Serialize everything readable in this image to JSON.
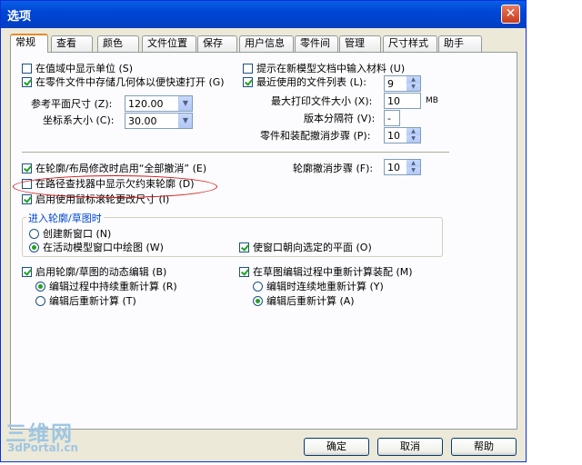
{
  "window": {
    "title": "选项",
    "close_glyph": "✕"
  },
  "tabs": [
    {
      "label": "常规"
    },
    {
      "label": "查看"
    },
    {
      "label": "颜色"
    },
    {
      "label": "文件位置"
    },
    {
      "label": "保存"
    },
    {
      "label": "用户信息"
    },
    {
      "label": "零件间"
    },
    {
      "label": "管理"
    },
    {
      "label": "尺寸样式"
    },
    {
      "label": "助手"
    }
  ],
  "active_tab": "常规",
  "general": {
    "show_units": {
      "label": "在值域中显示单位 (S)",
      "checked": false
    },
    "store_geometry": {
      "label": "在零件文件中存储几何体以便快速打开 (G)",
      "checked": true
    },
    "ref_plane_size": {
      "label": "参考平面尺寸 (Z):",
      "value": "120.00"
    },
    "coord_size": {
      "label": "坐标系大小 (C):",
      "value": "30.00"
    },
    "prompt_material": {
      "label": "提示在新模型文档中输入材料 (U)",
      "checked": false
    },
    "recent_files": {
      "label": "最近使用的文件列表 (L):",
      "checked": true,
      "value": "9"
    },
    "max_print": {
      "label": "最大打印文件大小 (X):",
      "value": "10",
      "unit": "MB"
    },
    "version_sep": {
      "label": "版本分隔符 (V):",
      "value": "-"
    },
    "undo_steps": {
      "label": "零件和装配撤消步骤 (P):",
      "value": "10"
    },
    "undo_all_profile": {
      "label": "在轮廓/布局修改时启用“全部撤消” (E)",
      "checked": true
    },
    "profile_undo_steps": {
      "label": "轮廓撤消步骤 (F):",
      "value": "10"
    },
    "show_underconstrained": {
      "label": "在路径查找器中显示欠约束轮廓 (D)",
      "checked": false
    },
    "mouse_wheel_size": {
      "label": "启用使用鼠标滚轮更改尺寸 (I)",
      "checked": true
    },
    "enter_sketch": {
      "title": "进入轮廓/草图时",
      "new_window": {
        "label": "创建新窗口 (N)",
        "selected": false
      },
      "active_window": {
        "label": "在活动模型窗口中绘图 (W)",
        "selected": true
      },
      "orient_window": {
        "label": "使窗口朝向选定的平面 (O)",
        "checked": true
      }
    },
    "dynamic_edit": {
      "label": "启用轮廓/草图的动态编辑 (B)",
      "checked": true,
      "recompute_during": {
        "label": "编辑过程中持续重新计算 (R)",
        "selected": true
      },
      "recompute_after": {
        "label": "编辑后重新计算 (T)",
        "selected": false
      }
    },
    "recompute_assembly": {
      "label": "在草图编辑过程中重新计算装配 (M)",
      "checked": true,
      "continuous": {
        "label": "编辑时连续地重新计算 (Y)",
        "selected": false
      },
      "after": {
        "label": "编辑后重新计算 (A)",
        "selected": true
      }
    }
  },
  "buttons": {
    "ok": "确定",
    "cancel": "取消",
    "help": "帮助"
  },
  "watermark": {
    "line1": "三维网",
    "line2": "3dPortal.cn"
  },
  "colors": {
    "title_bar": "#0046d5",
    "dialog_bg": "#ece9d8",
    "annotation": "#d21818",
    "check": "#21a121"
  }
}
